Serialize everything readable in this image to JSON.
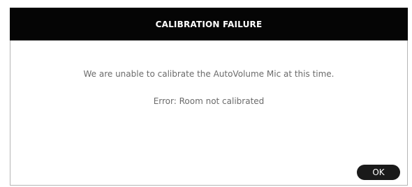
{
  "dialog": {
    "title": "CALIBRATION FAILURE",
    "message": "We are unable to calibrate the AutoVolume Mic at this time.",
    "error": "Error: Room not calibrated",
    "ok_label": "OK"
  },
  "colors": {
    "title_bar_background": "#050505",
    "title_text": "#ffffff",
    "body_text": "#6b6b6b",
    "button_background": "#1a1a1a",
    "button_text": "#ffffff"
  }
}
